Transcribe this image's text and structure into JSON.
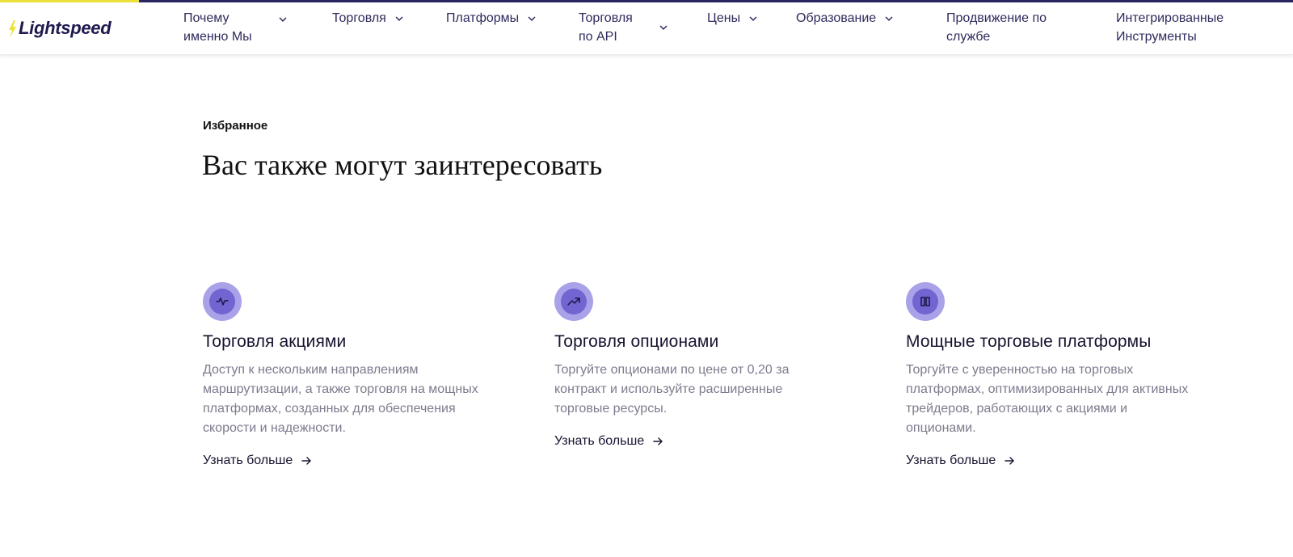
{
  "header": {
    "logo_text": "Lightspeed",
    "nav": [
      {
        "label": "Почему\nименно Мы",
        "has_dropdown": true
      },
      {
        "label": "Торговля",
        "has_dropdown": true
      },
      {
        "label": "Платформы",
        "has_dropdown": true
      },
      {
        "label": "Торговля\nпо API",
        "has_dropdown": true
      },
      {
        "label": "Цены",
        "has_dropdown": true
      },
      {
        "label": "Образование",
        "has_dropdown": true
      },
      {
        "label": "Продвижение по\nслужбе",
        "has_dropdown": false
      },
      {
        "label": "Интегрированные\nИнструменты",
        "has_dropdown": false
      }
    ]
  },
  "section": {
    "eyebrow": "Избранное",
    "headline": "Вас также могут заинтересовать"
  },
  "cards": [
    {
      "icon": "activity-pulse-icon",
      "title": "Торговля акциями",
      "text": "Доступ к нескольким направлениям\nмаршрутизации, а также торговля на мощных\nплатформах, созданных для обеспечения\nскорости и надежности.",
      "link": "Узнать больше"
    },
    {
      "icon": "trending-up-icon",
      "title": "Торговля опционами",
      "text": "Торгуйте опционами по цене от 0,20 за\nконтракт и используйте расширенные\nторговые ресурсы.",
      "link": "Узнать больше"
    },
    {
      "icon": "columns-icon",
      "title": "Мощные торговые платформы",
      "text": "Торгуйте с уверенностью на торговых\nплатформах, оптимизированных для активных\nтрейдеров, работающих с акциями и\nопционами.",
      "link": "Узнать больше"
    }
  ],
  "colors": {
    "brand_dark": "#2a2560",
    "brand_yellow": "#ece13a",
    "icon_outer": "#a9a2e9",
    "icon_inner": "#7264d1",
    "body_text": "#7d7b8d"
  }
}
